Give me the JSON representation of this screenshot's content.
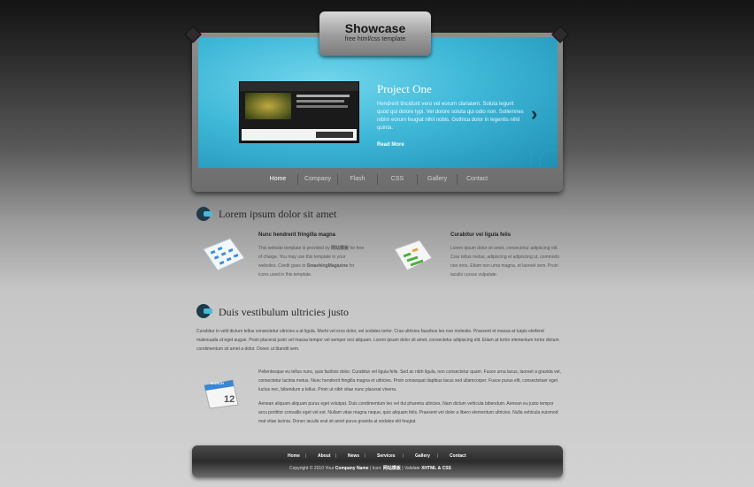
{
  "header": {
    "title": "Showcase",
    "subtitle": "free html/css template"
  },
  "slider": {
    "title": "Project One",
    "description": "Hendrerit tincidunt vero vel eorum clariatem. Soluta legunt quod qui dolore typi. Vel dolore soluta qui odio non. Sollemnes nibim eorum feugiat nihil nobis. Gothica dolor in legentis nihil quinta.",
    "read_more": "Read More",
    "next_icon": "chevron-right-icon"
  },
  "nav": {
    "items": [
      "Home",
      "Company",
      "Flash",
      "CSS",
      "Gallery",
      "Contact"
    ],
    "active": "Home"
  },
  "section1": {
    "title": "Lorem ipsum dolor sit amet",
    "left": {
      "title": "Nunc hendrerit fringilla magna",
      "text_a": "This website template is provided by ",
      "text_brand": "网站模板",
      "text_b": " for free of charge. You may use this template in your websites. Credit goes to ",
      "text_credit": "SmashingMagazine",
      "text_c": " for icons used in this template."
    },
    "right": {
      "title": "Curabitur vel ligula felis",
      "text": "Lorem ipsum dolor sit amet, consectetur adipiscing elit. Cras tellus metus, adipiscing et adipiscing ut, commodo non eros. Etiam non urna magna, et laoreet sem. Proin iaculis cursus vulputate."
    }
  },
  "section2": {
    "title": "Duis vestibulum ultricies justo",
    "intro": "Curabitur in velit dictum tellus consectetur ultricies a at ligula. Morbi vel eros dolor, vel sodales tortor. Cras ultricies faucibus leo non molestie. Praesent et massa at turpis eleifend malesuada ut eget augue. Proin placerat justo vel massa tempor vel semper orci aliquam. Lorem ipsum dolor sit amet, consectetur adipiscing elit. Etiam at tortor elementum tortor dictum condimentum sit amet a dolor. Donec ut blandit sem.",
    "para1": "Pellentesque eu tellus nunc, quis facilisis dolor. Curabitur vel ligula felis. Sed ac nibh ligula, non consectetur quam. Fusce urna lacus, laoreet a gravida vel, consectetur lacinia metus. Nunc hendrerit fringilla magna et ultricies. Proin consequat dapibus lacus sed ullamcorper. Fusce purus elit, consectetuer eget luctus nec, bibendum a tellus. Proin ut nibh vitae nunc placerat viverra.",
    "para2": "Aenean aliquam aliquam purus eget volutpat. Duis condimentum leo vel dui pharetra ultricies. Nam dictum vehicula bibendum. Aenean eu justo tempor arcu porttitor convallis eget vel est. Nullam vitae magna neque, quis aliquam felis. Praesent vel dolor a libero elementum ultricies. Nulla vehicula euismod mat vitae lacinia. Donec iaculis erat sit amet purus gravida at sodales elit feugiat.",
    "calendar": {
      "month": "MARCH",
      "day": "12"
    }
  },
  "footer": {
    "links": [
      "Home",
      "About",
      "News",
      "Services",
      "Gallery",
      "Contact"
    ],
    "copyright_prefix": "Copyright © 2010 Your ",
    "company": "Company Name",
    "copyright_mid": " | Icon: ",
    "icon_credit": "网站模板",
    "copyright_suffix": " | Validate ",
    "validate": "XHTML & CSS"
  },
  "colors": {
    "accent": "#3fb8d8",
    "bullet_dark": "#1e3b4a",
    "background_bottom": "#d2d2d2"
  }
}
